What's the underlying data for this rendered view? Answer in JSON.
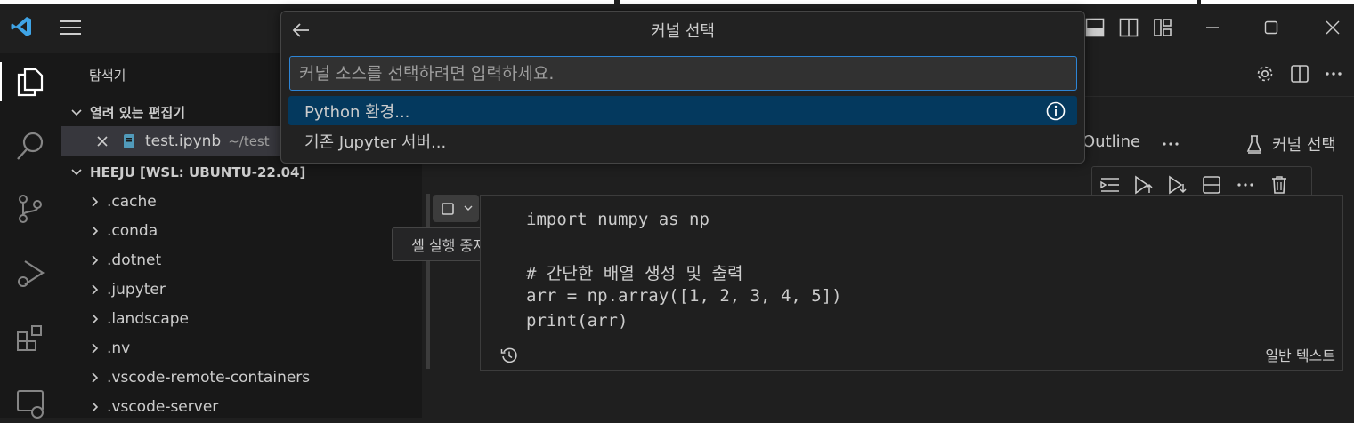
{
  "quickpick": {
    "title": "커널 선택",
    "placeholder": "커널 소스를 선택하려면 입력하세요.",
    "items": [
      {
        "label": "Python 환경...",
        "selected": true,
        "info_icon": "info-icon"
      },
      {
        "label": "기존 Jupyter 서버..."
      }
    ]
  },
  "sidebar": {
    "title": "탐색기",
    "open_editors": {
      "label": "열려 있는 편집기",
      "file_name": "test.ipynb",
      "file_path": "~/test"
    },
    "workspace": {
      "label": "HEEJU [WSL: UBUNTU-22.04]",
      "folders": [
        ".cache",
        ".conda",
        ".dotnet",
        ".jupyter",
        ".landscape",
        ".nv",
        ".vscode-remote-containers",
        ".vscode-server"
      ]
    }
  },
  "editor": {
    "outline_label": "Outline",
    "kernel_label": "커널 선택",
    "stop_tooltip": "셀 실행 중지",
    "cell_language": "일반 텍스트",
    "code_lines": [
      "import numpy as np",
      "",
      "# 간단한 배열 생성 및 출력",
      "arr = np.array([1, 2, 3, 4, 5])",
      "print(arr)"
    ]
  },
  "colors": {
    "accent": "#2d85d6",
    "selection": "#04395e",
    "vscode_blue": "#3fa4e6"
  }
}
